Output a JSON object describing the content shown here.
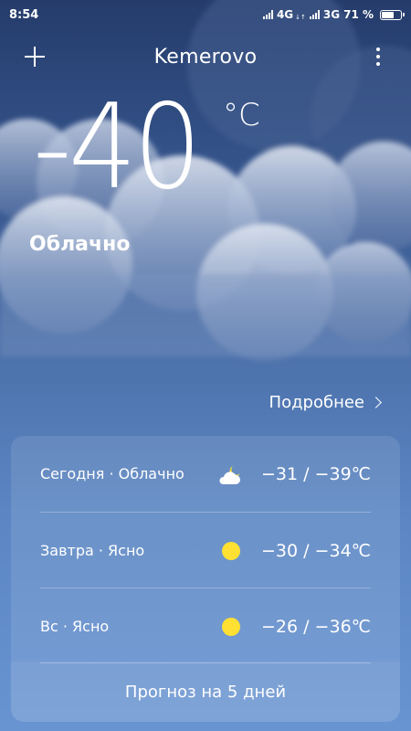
{
  "status_bar": {
    "time": "8:54",
    "network_1": "4G",
    "network_1_sub": "↓↑",
    "network_2": "3G",
    "battery": "71 %",
    "battery_level": 0.71
  },
  "header": {
    "add_icon": "plus-icon",
    "city": "Kemerovo",
    "menu_icon": "more-vertical-icon"
  },
  "current": {
    "temperature": "-40",
    "unit": "°C",
    "condition": "Облачно"
  },
  "details_link": "Подробнее",
  "forecast": [
    {
      "label": "Сегодня · Облачно",
      "icon": "partly-cloudy-night-icon",
      "temps": "−31  /  −39℃"
    },
    {
      "label": "Завтра · Ясно",
      "icon": "sun-icon",
      "temps": "−30  /  −34℃"
    },
    {
      "label": "Вс · Ясно",
      "icon": "sun-icon",
      "temps": "−26  /  −36℃"
    }
  ],
  "five_day_button": "Прогноз на 5 дней",
  "colors": {
    "sun": "#ffe033",
    "background_top": "#253c6b",
    "background_bottom": "#6894d2"
  }
}
